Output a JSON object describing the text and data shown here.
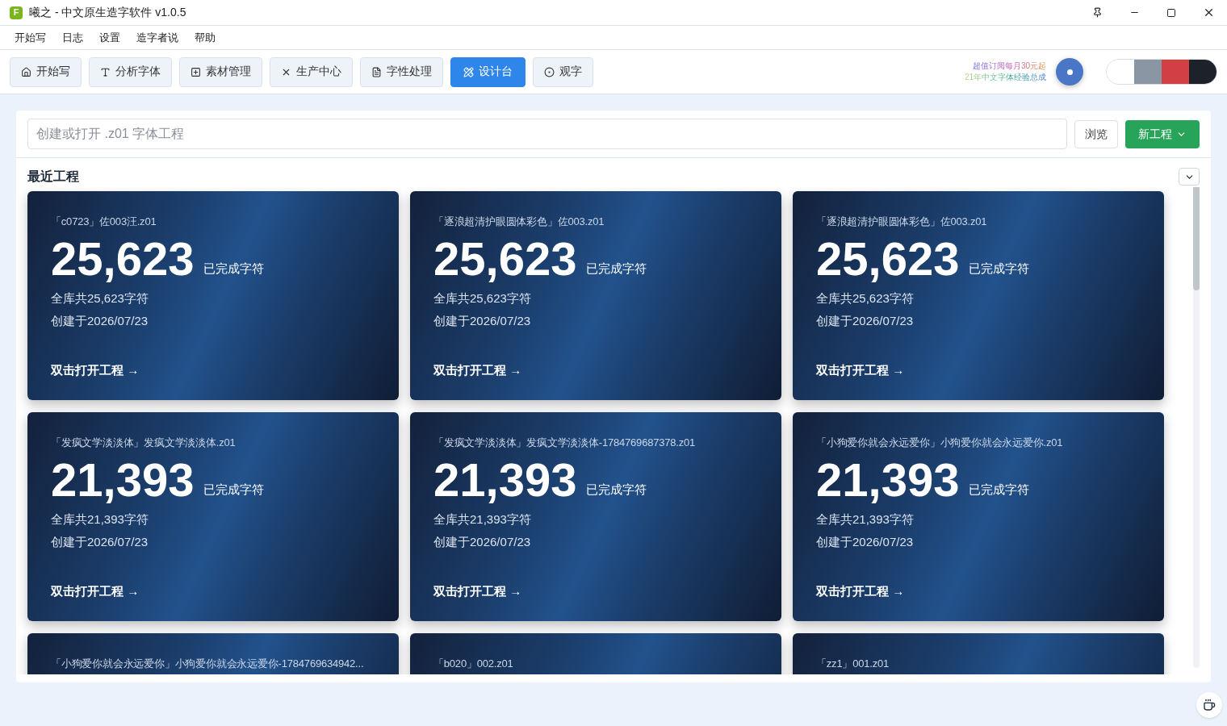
{
  "window": {
    "logo": "F",
    "title": "曦之 - 中文原生造字软件 v1.0.5"
  },
  "menu": [
    "开始写",
    "日志",
    "设置",
    "造字者说",
    "帮助"
  ],
  "toolbar": [
    {
      "label": "开始写",
      "selected": false
    },
    {
      "label": "分析字体",
      "selected": false
    },
    {
      "label": "素材管理",
      "selected": false
    },
    {
      "label": "生产中心",
      "selected": false
    },
    {
      "label": "字性处理",
      "selected": false
    },
    {
      "label": "设计台",
      "selected": true
    },
    {
      "label": "观字",
      "selected": false
    }
  ],
  "promo": [
    "超值订阅每月30元起",
    "21年中文字体经验总成"
  ],
  "theme_swatches": [
    {
      "color": "#ffffff"
    },
    {
      "color": "#8a96a3"
    },
    {
      "color": "#d24043"
    },
    {
      "color": "#1d2129"
    }
  ],
  "project_field": {
    "placeholder": "创建或打开 .z01 字体工程"
  },
  "browse_button": "浏览",
  "new_button": "新工程",
  "recent": {
    "title": "最近工程",
    "cards": [
      {
        "title": "「c0723」佐003汪.z01",
        "count": "25,623",
        "count_label": "已完成字符",
        "total": "全库共25,623字符",
        "created": "创建于2026/07/23",
        "action": "双击打开工程 →"
      },
      {
        "title": "「逐浪超清护眼圆体彩色」佐003.z01",
        "count": "25,623",
        "count_label": "已完成字符",
        "total": "全库共25,623字符",
        "created": "创建于2026/07/23",
        "action": "双击打开工程 →"
      },
      {
        "title": "「逐浪超清护眼圆体彩色」佐003.z01",
        "count": "25,623",
        "count_label": "已完成字符",
        "total": "全库共25,623字符",
        "created": "创建于2026/07/23",
        "action": "双击打开工程 →"
      },
      {
        "title": "「发疯文学淡淡体」发疯文学淡淡体.z01",
        "count": "21,393",
        "count_label": "已完成字符",
        "total": "全库共21,393字符",
        "created": "创建于2026/07/23",
        "action": "双击打开工程 →"
      },
      {
        "title": "「发疯文学淡淡体」发疯文学淡淡体-1784769687378.z01",
        "count": "21,393",
        "count_label": "已完成字符",
        "total": "全库共21,393字符",
        "created": "创建于2026/07/23",
        "action": "双击打开工程 →"
      },
      {
        "title": "「小狗爱你就会永远爱你」小狗爱你就会永远爱你.z01",
        "count": "21,393",
        "count_label": "已完成字符",
        "total": "全库共21,393字符",
        "created": "创建于2026/07/23",
        "action": "双击打开工程 →"
      },
      {
        "title": "「小狗爱你就会永远爱你」小狗爱你就会永远爱你-1784769634942..."
      },
      {
        "title": "「b020」002.z01"
      },
      {
        "title": "「zz1」001.z01"
      }
    ]
  }
}
